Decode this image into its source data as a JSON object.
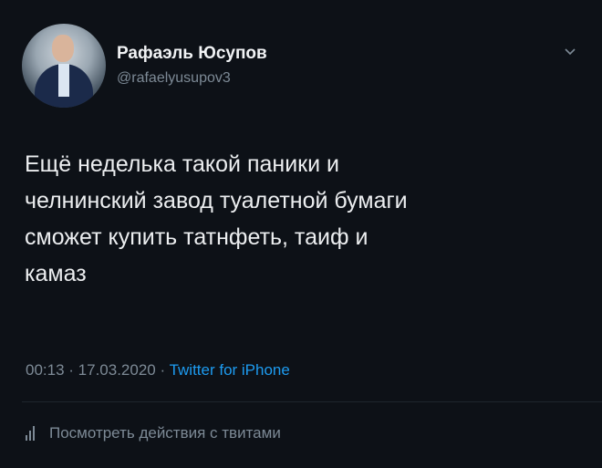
{
  "tweet": {
    "author": {
      "display_name": "Рафаэль Юсупов",
      "handle": "@rafaelyusupov3"
    },
    "text": "Ещё неделька  такой паники и\nчелнинский завод туалетной бумаги\nсможет купить татнфеть, таиф и\nкамаз",
    "meta": {
      "time": "00:13",
      "separator_1": " · ",
      "date": "17.03.2020",
      "separator_2": " · ",
      "source": "Twitter for iPhone"
    },
    "activity_label": "Посмотреть действия с твитами"
  },
  "colors": {
    "background": "#0d1117",
    "text": "#eceef0",
    "secondary": "#7d8a96",
    "link": "#1d9bf0"
  },
  "icons": {
    "menu": "chevron-down-icon",
    "activity": "bar-chart-icon"
  }
}
